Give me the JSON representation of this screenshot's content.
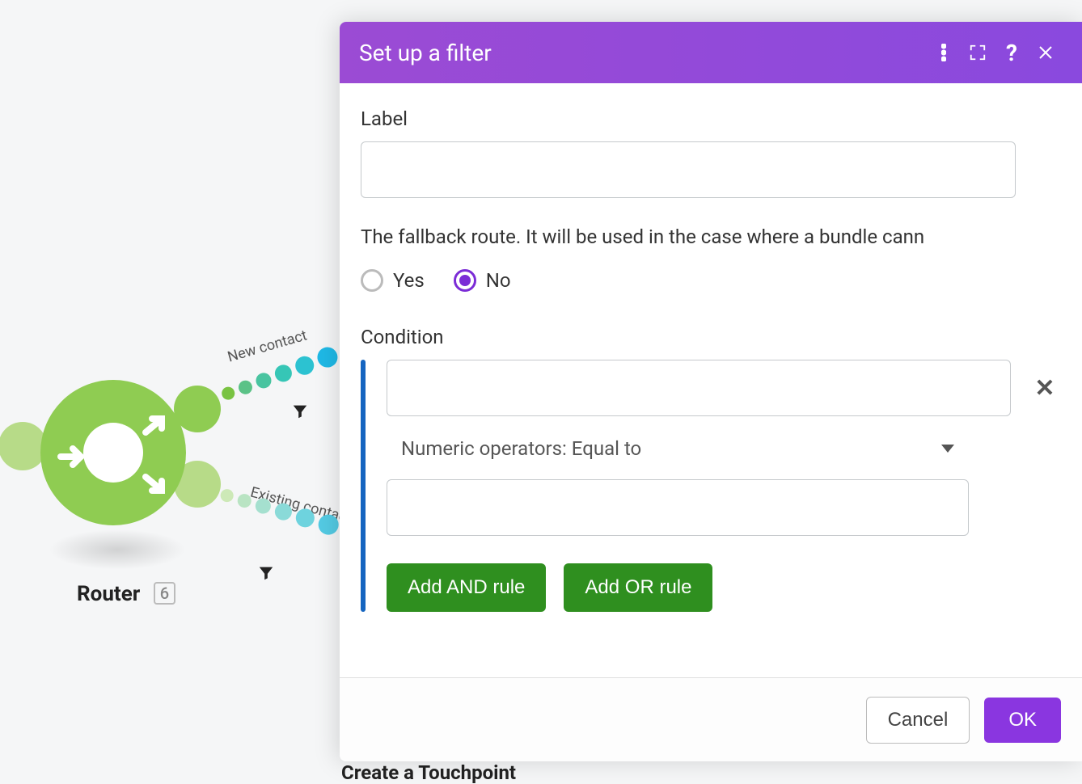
{
  "canvas": {
    "router_label": "Router",
    "router_badge": "6",
    "routes": {
      "new_label": "New contact",
      "existing_label": "Existing contac"
    },
    "bottom_cut_label": "Create a Touchpoint"
  },
  "modal": {
    "title": "Set up a filter",
    "label_field_label": "Label",
    "label_value": "",
    "fallback_description": "The fallback route. It will be used in the case where a bundle cann",
    "fallback": {
      "yes_label": "Yes",
      "no_label": "No",
      "selected": "no"
    },
    "condition_label": "Condition",
    "condition": {
      "field_a_value": "",
      "operator_text": "Numeric operators: Equal to",
      "field_b_value": ""
    },
    "buttons": {
      "add_and": "Add AND rule",
      "add_or": "Add OR rule",
      "cancel": "Cancel",
      "ok": "OK"
    }
  }
}
